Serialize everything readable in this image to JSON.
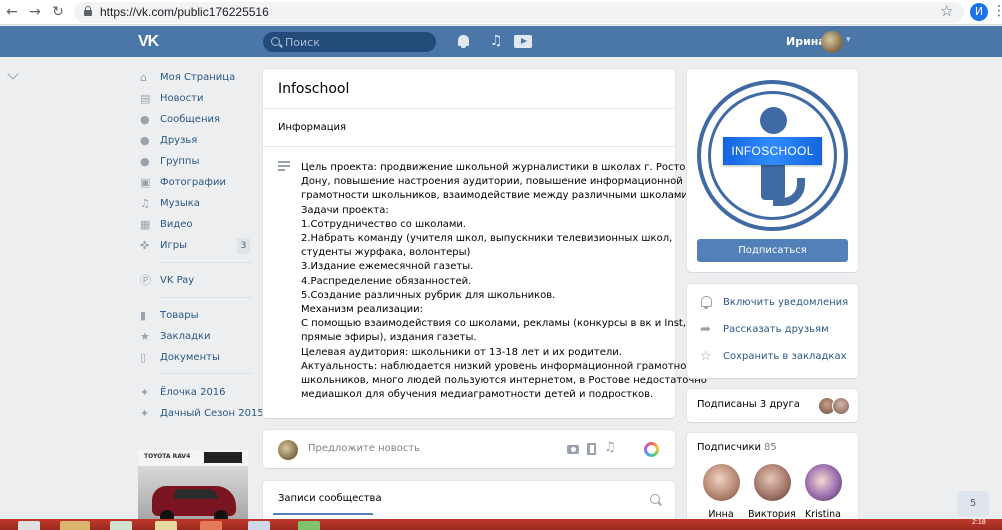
{
  "browser": {
    "url": "https://vk.com/public176225516",
    "profile_initial": "И"
  },
  "header": {
    "logo": "VK",
    "search_placeholder": "Поиск",
    "user_name": "Ирина"
  },
  "sidebar": {
    "items": [
      {
        "label": "Моя Страница",
        "icon": "home-icon"
      },
      {
        "label": "Новости",
        "icon": "news-icon"
      },
      {
        "label": "Сообщения",
        "icon": "messages-icon"
      },
      {
        "label": "Друзья",
        "icon": "friends-icon"
      },
      {
        "label": "Группы",
        "icon": "groups-icon"
      },
      {
        "label": "Фотографии",
        "icon": "photo-icon"
      },
      {
        "label": "Музыка",
        "icon": "music-icon"
      },
      {
        "label": "Видео",
        "icon": "video-icon"
      },
      {
        "label": "Игры",
        "icon": "games-icon",
        "badge": "3"
      },
      {
        "label": "VK Pay",
        "icon": "vkpay-icon"
      },
      {
        "label": "Товары",
        "icon": "goods-icon"
      },
      {
        "label": "Закладки",
        "icon": "bookmarks-icon"
      },
      {
        "label": "Документы",
        "icon": "documents-icon"
      },
      {
        "label": "Ёлочка 2016",
        "icon": "app-icon"
      },
      {
        "label": "Дачный Сезон 2015",
        "icon": "app-icon"
      }
    ],
    "ad_brand": "TOYOTA RAV4"
  },
  "community": {
    "title": "Infoschool",
    "info_tab": "Информация",
    "description_lines": [
      "Цель проекта: продвижение школьной журналистики в школах г. Ростова на",
      "Дону, повышение настроения аудитории, повышение информационной",
      "грамотности школьников, взаимодействие между различными школами.",
      "Задачи проекта:",
      "1.Сотрудничество со школами.",
      "2.Набрать команду (учителя школ, выпускники телевизионных школ,",
      "студенты журфака, волонтеры)",
      "3.Издание ежемесячной газеты.",
      "4.Распределение обязанностей.",
      "5.Создание различных рубрик для школьников.",
      "Механизм реализации:",
      "С помощью взаимодействия со школами, рекламы (конкурсы в вк и Inst,",
      "прямые эфиры), издания газеты.",
      "Целевая аудитория: школьники от 13-18 лет и их родители.",
      "Актуальность: наблюдается низкий уровень информационной грамотности у",
      "школьников, много людей пользуются интернетом, в Ростове недостаточно",
      "медиашкол для обучения медиаграмотности детей и подростков."
    ],
    "composer_placeholder": "Предложите новость",
    "posts_tab": "Записи сообщества"
  },
  "right": {
    "logo_text": "INFOSCHOOL",
    "subscribe_label": "Подписаться",
    "actions": [
      {
        "label": "Включить уведомления",
        "icon": "bell-icon"
      },
      {
        "label": "Рассказать друзьям",
        "icon": "share-icon"
      },
      {
        "label": "Сохранить в закладках",
        "icon": "star-icon"
      }
    ],
    "friends_subscribed": "Подписаны 3 друга",
    "members_title": "Подписчики",
    "members_count": "85",
    "members": [
      {
        "name": "Инна"
      },
      {
        "name": "Виктория"
      },
      {
        "name": "Kristina"
      }
    ]
  },
  "scroll_badge": "5",
  "taskbar_clock": "2:18"
}
